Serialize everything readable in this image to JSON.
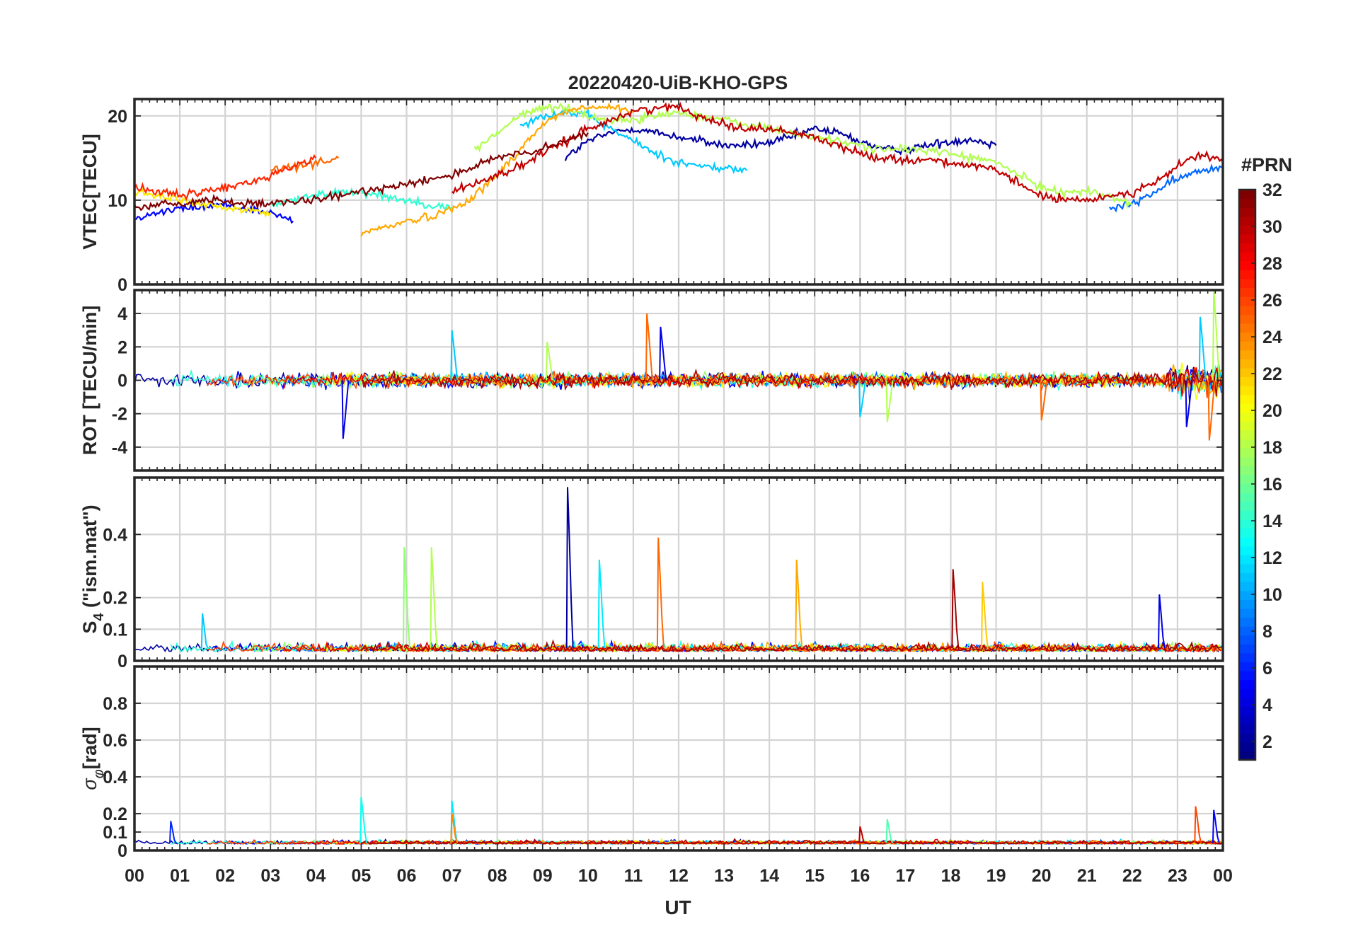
{
  "title": "20220420-UiB-KHO-GPS",
  "xlabel": "UT",
  "x_tick_labels": [
    "00",
    "01",
    "02",
    "03",
    "04",
    "05",
    "06",
    "07",
    "08",
    "09",
    "10",
    "11",
    "12",
    "13",
    "14",
    "15",
    "16",
    "17",
    "18",
    "19",
    "20",
    "21",
    "22",
    "23",
    "00"
  ],
  "colorbar": {
    "label": "#PRN",
    "range": [
      1,
      32
    ],
    "tick_labels": [
      "2",
      "4",
      "6",
      "8",
      "10",
      "12",
      "14",
      "16",
      "18",
      "20",
      "22",
      "24",
      "26",
      "28",
      "30",
      "32"
    ],
    "colormap": "jet"
  },
  "chart_data": [
    {
      "type": "line",
      "panel": "VTEC",
      "ylabel": "VTEC[TECU]",
      "ylim": [
        0,
        22
      ],
      "yticks": [
        "0",
        "10",
        "20"
      ],
      "x_units": "UT hours",
      "grid": true,
      "series": [
        {
          "prn": 2,
          "x": [
            9.5,
            10,
            10.5,
            11,
            11.5,
            12,
            12.5,
            13,
            13.5,
            14,
            14.5,
            15,
            15.5,
            16,
            16.5,
            17,
            17.5,
            18,
            18.5,
            19
          ],
          "values": [
            15,
            17,
            18,
            18.5,
            18,
            17.5,
            17,
            16.5,
            16.5,
            16.8,
            17.5,
            18.5,
            18,
            17,
            16,
            16,
            16.5,
            17,
            17.2,
            16.5
          ]
        },
        {
          "prn": 5,
          "x": [
            0,
            0.5,
            1,
            1.5,
            2,
            2.5,
            3,
            3.5
          ],
          "values": [
            8,
            8.5,
            9,
            9.2,
            9.5,
            9,
            8.5,
            7.5
          ]
        },
        {
          "prn": 8,
          "x": [
            21.5,
            22,
            22.5,
            23,
            23.5,
            24
          ],
          "values": [
            9,
            9.5,
            11,
            12.5,
            13.5,
            14
          ]
        },
        {
          "prn": 11,
          "x": [
            8.5,
            9,
            9.5,
            10,
            10.5,
            11,
            11.5,
            12,
            12.5,
            13,
            13.5
          ],
          "values": [
            19,
            20,
            20.5,
            20,
            18.5,
            17,
            15.5,
            14.5,
            14,
            13.8,
            13.5
          ]
        },
        {
          "prn": 14,
          "x": [
            3,
            3.5,
            4,
            4.5,
            5,
            5.5,
            6,
            6.5,
            7
          ],
          "values": [
            9.5,
            10,
            10.5,
            11,
            11,
            10.5,
            10,
            9.5,
            9
          ]
        },
        {
          "prn": 18,
          "x": [
            7.5,
            8,
            8.5,
            9,
            9.5,
            10,
            10.5,
            11,
            11.5,
            12,
            12.5,
            13,
            13.5,
            14,
            14.5,
            15,
            15.5,
            16,
            16.5,
            17,
            17.5,
            18,
            18.5,
            19,
            19.5,
            20,
            20.5,
            21,
            21.5,
            22
          ],
          "values": [
            16,
            18,
            20,
            21,
            21,
            20,
            19.5,
            19.5,
            20,
            20.5,
            20,
            19.5,
            19,
            18.5,
            18,
            17.5,
            17,
            16.5,
            16,
            16,
            16,
            15.5,
            15,
            14.5,
            13,
            11.5,
            11,
            11,
            10.5,
            9.5
          ]
        },
        {
          "prn": 21,
          "x": [
            0,
            0.5,
            1,
            1.5,
            2,
            2.5,
            3
          ],
          "values": [
            11,
            10.5,
            10,
            9.5,
            9,
            8.8,
            8.5
          ]
        },
        {
          "prn": 23,
          "x": [
            5,
            5.5,
            6,
            6.5,
            7,
            7.5,
            8,
            8.5,
            9,
            9.5,
            10,
            10.5,
            11
          ],
          "values": [
            6,
            6.8,
            7.5,
            8,
            9,
            10.5,
            13,
            16,
            19,
            20.5,
            21,
            21,
            20.5
          ]
        },
        {
          "prn": 25,
          "x": [
            3,
            3.5,
            4,
            4.5
          ],
          "values": [
            13.5,
            14,
            14.5,
            15
          ]
        },
        {
          "prn": 27,
          "x": [
            0,
            0.5,
            1,
            1.5,
            2,
            2.5,
            3,
            3.5,
            4
          ],
          "values": [
            11.5,
            11,
            10.5,
            11,
            11.5,
            12,
            13,
            14,
            15
          ]
        },
        {
          "prn": 30,
          "x": [
            7,
            7.5,
            8,
            8.5,
            9,
            9.5,
            10,
            10.5,
            11,
            11.5,
            12,
            12.5,
            13,
            13.5,
            14,
            14.5,
            15,
            15.5,
            16,
            16.5,
            17,
            17.5,
            18,
            18.5,
            19,
            19.5,
            20,
            20.5,
            21,
            21.5,
            22,
            22.5,
            23,
            23.5,
            24
          ],
          "values": [
            11,
            12,
            13,
            14,
            15.5,
            17,
            18.5,
            19.5,
            20.5,
            21,
            21,
            20,
            19,
            18.5,
            18.5,
            18,
            17.5,
            16.5,
            15.5,
            15,
            14.8,
            14.8,
            14.5,
            14,
            13.5,
            12,
            10.5,
            10,
            10,
            10.5,
            11,
            12,
            14,
            15.5,
            14.5
          ]
        },
        {
          "prn": 32,
          "x": [
            0,
            0.5,
            1,
            1.5,
            2,
            2.5,
            3,
            3.5,
            4,
            4.5,
            5,
            5.5,
            6,
            6.5,
            7,
            7.5,
            8,
            8.5,
            9,
            9.5,
            10
          ],
          "values": [
            9,
            9.5,
            9.5,
            10,
            10,
            9.5,
            9.5,
            9.8,
            10,
            10.5,
            11,
            11.5,
            12,
            12.5,
            13,
            14,
            15,
            15.5,
            16,
            17,
            18
          ]
        }
      ]
    },
    {
      "type": "line",
      "panel": "ROT",
      "ylabel": "ROT [TECU/min]",
      "ylim": [
        -5.4,
        5.4
      ],
      "yticks": [
        "-4",
        "-2",
        "0",
        "2",
        "4"
      ],
      "x_units": "UT hours",
      "grid": true,
      "note_values": "noise band about 0 TECU/min with spikes",
      "spikes": [
        {
          "x": 4.6,
          "y": -3.5
        },
        {
          "x": 7.0,
          "y": 3.0
        },
        {
          "x": 9.1,
          "y": 2.3
        },
        {
          "x": 11.3,
          "y": 4.0
        },
        {
          "x": 11.6,
          "y": 3.2
        },
        {
          "x": 16.0,
          "y": -2.2
        },
        {
          "x": 16.6,
          "y": -2.5
        },
        {
          "x": 20.0,
          "y": -2.4
        },
        {
          "x": 23.2,
          "y": -2.8
        },
        {
          "x": 23.5,
          "y": 3.8
        },
        {
          "x": 23.8,
          "y": 5.4
        },
        {
          "x": 23.7,
          "y": -3.6
        }
      ]
    },
    {
      "type": "line",
      "panel": "S4",
      "ylabel": "S4 (\"ism.mat\")",
      "ylabel_main": "S",
      "ylabel_sub": "4",
      "ylabel_rest": " (\"ism.mat\")",
      "ylim": [
        0,
        0.58
      ],
      "yticks": [
        "0",
        "0.1",
        "0.2",
        "0.4"
      ],
      "x_units": "UT hours",
      "grid": true,
      "note_values": "background about 0.02-0.05 with spikes",
      "spikes": [
        {
          "x": 5.95,
          "y": 0.36,
          "prn": 17
        },
        {
          "x": 6.55,
          "y": 0.36,
          "prn": 18
        },
        {
          "x": 9.55,
          "y": 0.55,
          "prn": 2
        },
        {
          "x": 10.25,
          "y": 0.32,
          "prn": 12
        },
        {
          "x": 11.55,
          "y": 0.39,
          "prn": 25
        },
        {
          "x": 14.6,
          "y": 0.32,
          "prn": 23
        },
        {
          "x": 18.05,
          "y": 0.29,
          "prn": 31
        },
        {
          "x": 18.7,
          "y": 0.25,
          "prn": 22
        },
        {
          "x": 22.6,
          "y": 0.21,
          "prn": 4
        },
        {
          "x": 1.5,
          "y": 0.15,
          "prn": 11
        }
      ]
    },
    {
      "type": "line",
      "panel": "sigma_phi",
      "ylabel": "σφ[rad]",
      "ylabel_main": "σ",
      "ylabel_sub": "φ",
      "ylabel_rest": "[rad]",
      "ylim": [
        0,
        1.0
      ],
      "yticks": [
        "0",
        "0.1",
        "0.2",
        "0.4",
        "0.6",
        "0.8"
      ],
      "x_units": "UT hours",
      "grid": true,
      "note_values": "background about 0.03-0.06 with spikes",
      "spikes": [
        {
          "x": 0.8,
          "y": 0.16,
          "prn": 6
        },
        {
          "x": 5.0,
          "y": 0.29,
          "prn": 13
        },
        {
          "x": 7.0,
          "y": 0.27,
          "prn": 12
        },
        {
          "x": 7.0,
          "y": 0.2,
          "prn": 24
        },
        {
          "x": 16.0,
          "y": 0.13,
          "prn": 30
        },
        {
          "x": 16.6,
          "y": 0.17,
          "prn": 15
        },
        {
          "x": 23.4,
          "y": 0.24,
          "prn": 26
        },
        {
          "x": 23.8,
          "y": 0.22,
          "prn": 5
        }
      ]
    }
  ]
}
